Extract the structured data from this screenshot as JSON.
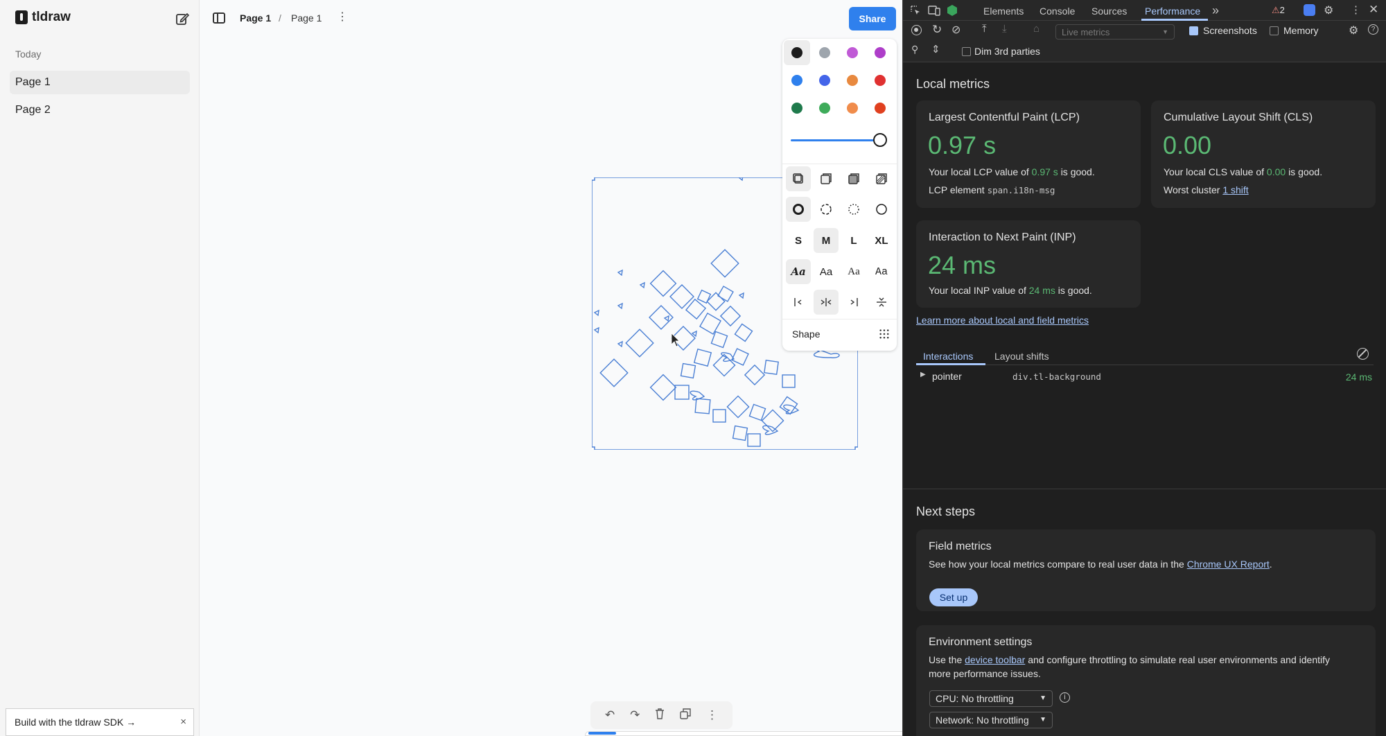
{
  "app": {
    "name": "tldraw"
  },
  "sidebar": {
    "section_label": "Today",
    "pages": [
      {
        "label": "Page 1",
        "active": true
      },
      {
        "label": "Page 2",
        "active": false
      }
    ],
    "sdk_banner": {
      "label": "Build with the tldraw SDK →",
      "close": "×"
    }
  },
  "header": {
    "breadcrumb": [
      "Page 1",
      "Page 1"
    ],
    "separator": "/",
    "more_glyph": "⋮",
    "share_label": "Share"
  },
  "style_panel": {
    "colors": [
      "#1d1d1d",
      "#9ea5ad",
      "#c05ad6",
      "#ae3ec9",
      "#2f80ed",
      "#4465e9",
      "#e8893f",
      "#e03131",
      "#1f7a4c",
      "#3eab5a",
      "#f08c4b",
      "#e0401f"
    ],
    "selected_color_index": 0,
    "opacity_percent": 100,
    "fill_options": [
      "fill-none-icon",
      "fill-semi-icon",
      "fill-solid-icon",
      "fill-pattern-icon"
    ],
    "selected_fill_index": 0,
    "dash_options": [
      "dash-draw-icon",
      "dash-dashed-icon",
      "dash-dotted-icon",
      "dash-solid-icon"
    ],
    "selected_dash_index": 0,
    "sizes": [
      "S",
      "M",
      "L",
      "XL"
    ],
    "selected_size_index": 1,
    "font_options": [
      "Aa",
      "Aa",
      "Aa",
      "Aa"
    ],
    "selected_font_index": 0,
    "align_options": [
      "align-start-icon",
      "align-middle-icon",
      "align-end-icon",
      "align-justify-icon"
    ],
    "selected_align_index": 1,
    "shape_label": "Shape"
  },
  "bottom_toolbar": {
    "undo_glyph": "↶",
    "redo_glyph": "↷",
    "delete_glyph": "🗑",
    "duplicate_glyph": "❐",
    "more_glyph": "⋮"
  },
  "devtools": {
    "tabs": [
      "Elements",
      "Console",
      "Sources",
      "Performance"
    ],
    "active_tab": "Performance",
    "more_tabs_glyph": "»",
    "warning_count": "2",
    "toolbar": {
      "mode_placeholder": "Live metrics",
      "screenshots_label": "Screenshots",
      "screenshots_checked": true,
      "memory_label": "Memory",
      "memory_checked": false,
      "dim_label": "Dim 3rd parties",
      "dim_checked": false
    },
    "local_metrics": {
      "heading": "Local metrics",
      "lcp": {
        "title": "Largest Contentful Paint (LCP)",
        "value": "0.97 s",
        "line_prefix": "Your local LCP value of",
        "line_value": "0.97 s",
        "line_suffix": "is good.",
        "element_label": "LCP element",
        "element_value": "span.i18n-msg"
      },
      "cls": {
        "title": "Cumulative Layout Shift (CLS)",
        "value": "0.00",
        "line_prefix": "Your local CLS value of",
        "line_value": "0.00",
        "line_suffix": "is good.",
        "worst_label": "Worst cluster",
        "worst_value": "1 shift"
      },
      "inp": {
        "title": "Interaction to Next Paint (INP)",
        "value": "24 ms",
        "line_prefix": "Your local INP value of",
        "line_value": "24 ms",
        "line_suffix": "is good."
      },
      "learn_more": "Learn more about local and field metrics"
    },
    "subtabs": [
      "Interactions",
      "Layout shifts"
    ],
    "interactions": [
      {
        "type": "pointer",
        "target": "div.tl-background",
        "duration": "24 ms"
      }
    ],
    "next_steps": {
      "heading": "Next steps",
      "field": {
        "title": "Field metrics",
        "text_prefix": "See how your local metrics compare to real user data in the",
        "link": "Chrome UX Report",
        "text_suffix": ".",
        "button": "Set up"
      },
      "env": {
        "title": "Environment settings",
        "text_prefix": "Use the",
        "link": "device toolbar",
        "text_line1_suffix": "and configure throttling to simulate real user environments and identify",
        "text_line2": "more performance issues.",
        "cpu": "CPU: No throttling",
        "network": "Network: No throttling"
      }
    }
  }
}
